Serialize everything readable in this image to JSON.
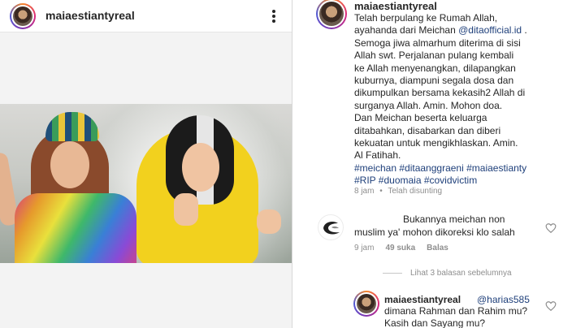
{
  "post": {
    "username": "maiaestiantyreal"
  },
  "caption": {
    "username": "maiaestiantyreal",
    "line1": "Telah berpulang ke Rumah Allah,",
    "line2_prefix": "ayahanda dari Meichan ",
    "line2_mention": "@ditaofficial.id",
    "line2_suffix": " .",
    "line3": "Semoga jiwa almarhum diterima di sisi",
    "line4": "Allah swt. Perjalanan pulang kembali",
    "line5": "ke Allah menyenangkan, dilapangkan",
    "line6": "kuburnya, diampuni segala dosa dan",
    "line7": "dikumpulkan bersama kekasih2 Allah di",
    "line8": "surganya Allah. Amin. Mohon doa.",
    "line9": "Dan Meichan beserta keluarga",
    "line10": "ditabahkan, disabarkan dan diberi",
    "line11": "kekuatan untuk mengikhlaskan. Amin.",
    "line12": "Al Fatihah.",
    "hashtags1": "#meichan #ditaanggraeni #maiaestianty",
    "hashtags2": "#RIP #duomaia #covidvictim",
    "time": "8 jam",
    "separator": "•",
    "edited": "Telah disunting"
  },
  "comment1": {
    "line1": "Bukannya meichan non",
    "line2": "muslim ya' mohon dikoreksi klo salah",
    "time": "9 jam",
    "likes": "49 suka",
    "reply": "Balas"
  },
  "view_replies": "Lihat 3 balasan sebelumnya",
  "reply": {
    "username": "maiaestiantyreal",
    "mention": "@harias585",
    "line1": "dimana Rahman dan Rahim mu?",
    "line2": "Kasih dan Sayang mu?"
  },
  "colors": {
    "link": "#1e3f7a",
    "meta": "#8e8e8e",
    "text": "#262626"
  },
  "icons": [
    "more-options-icon",
    "heart-icon",
    "avatar-icon",
    "commenter-logo-icon"
  ]
}
